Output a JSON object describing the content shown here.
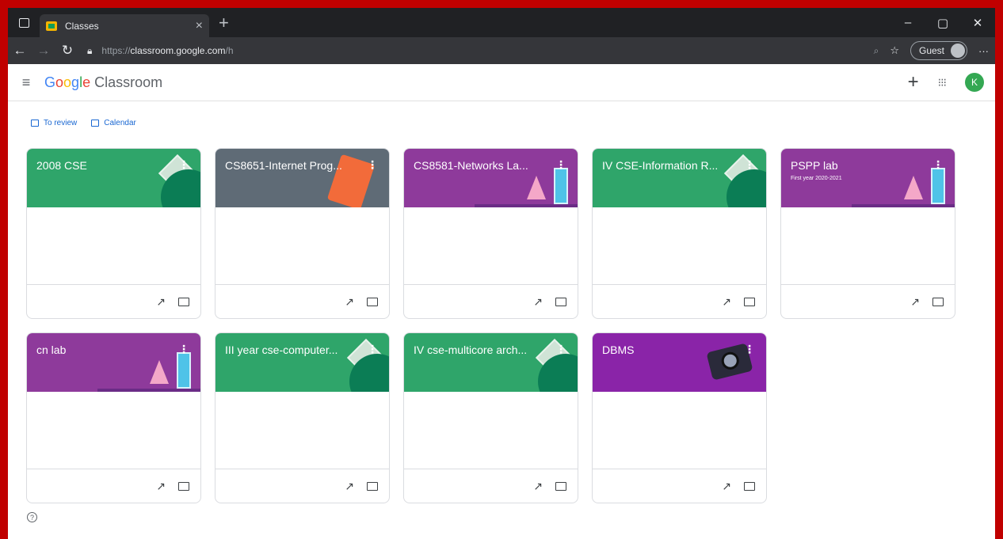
{
  "browser": {
    "tab_title": "Classes",
    "tab_close": "×",
    "new_tab": "+",
    "url_prefix": "https://",
    "url_host": "classroom.google.com",
    "url_path": "/h",
    "guest_label": "Guest",
    "window_controls": [
      "–",
      "▢",
      "✕"
    ],
    "more_icon": "···"
  },
  "app": {
    "logo_google": [
      "G",
      "o",
      "o",
      "g",
      "l",
      "e"
    ],
    "logo_product": "Classroom",
    "avatar_letter": "K",
    "accent": "#34a853"
  },
  "quicklinks": {
    "to_review": "To review",
    "calendar": "Calendar"
  },
  "classes": [
    {
      "name": "2008 CSE",
      "section": "",
      "theme": "green",
      "decor": "diamond"
    },
    {
      "name": "CS8651-Internet Prog...",
      "section": "",
      "theme": "grey",
      "decor": "book"
    },
    {
      "name": "CS8581-Networks La...",
      "section": "",
      "theme": "purple",
      "decor": "lab"
    },
    {
      "name": "IV CSE-Information R...",
      "section": "",
      "theme": "green",
      "decor": "diamond"
    },
    {
      "name": "PSPP lab",
      "section": "First year 2020-2021",
      "theme": "purple",
      "decor": "lab"
    },
    {
      "name": "cn lab",
      "section": "",
      "theme": "purple",
      "decor": "lab"
    },
    {
      "name": "III year cse-computer...",
      "section": "",
      "theme": "green",
      "decor": "diamond"
    },
    {
      "name": "IV cse-multicore arch...",
      "section": "",
      "theme": "green",
      "decor": "diamond"
    },
    {
      "name": "DBMS",
      "section": "",
      "theme": "violet",
      "decor": "camera"
    }
  ],
  "colors": {
    "green": "#2fa56a",
    "grey": "#5f6b76",
    "purple": "#8e3a9b",
    "violet": "#8a24a8",
    "link_blue": "#1967d2",
    "frame_red": "#c00000"
  }
}
